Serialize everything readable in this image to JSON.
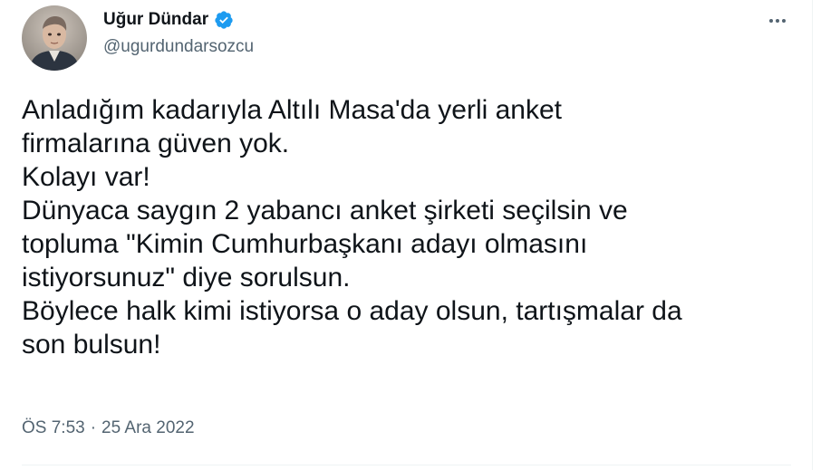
{
  "author": {
    "name": "Uğur Dündar",
    "handle": "@ugurdundarsozcu",
    "verified_icon": "verified-badge-icon",
    "verified_color": "#1d9bf0"
  },
  "more_menu_icon": "more-horizontal-icon",
  "tweet": {
    "lines": [
      "Anladığım kadarıyla Altılı Masa'da yerli anket",
      "firmalarına güven yok.",
      "Kolayı var!",
      "Dünyaca saygın 2 yabancı anket şirketi seçilsin ve",
      "topluma \"Kimin Cumhurbaşkanı adayı olmasını",
      "istiyorsunuz\" diye sorulsun.",
      "Böylece halk kimi istiyorsa o aday olsun, tartışmalar da",
      "son bulsun!"
    ],
    "time": "ÖS 7:53",
    "separator": "·",
    "date": "25 Ara 2022"
  },
  "colors": {
    "text_primary": "#0f1419",
    "text_secondary": "#536471",
    "divider": "#eff3f4"
  }
}
